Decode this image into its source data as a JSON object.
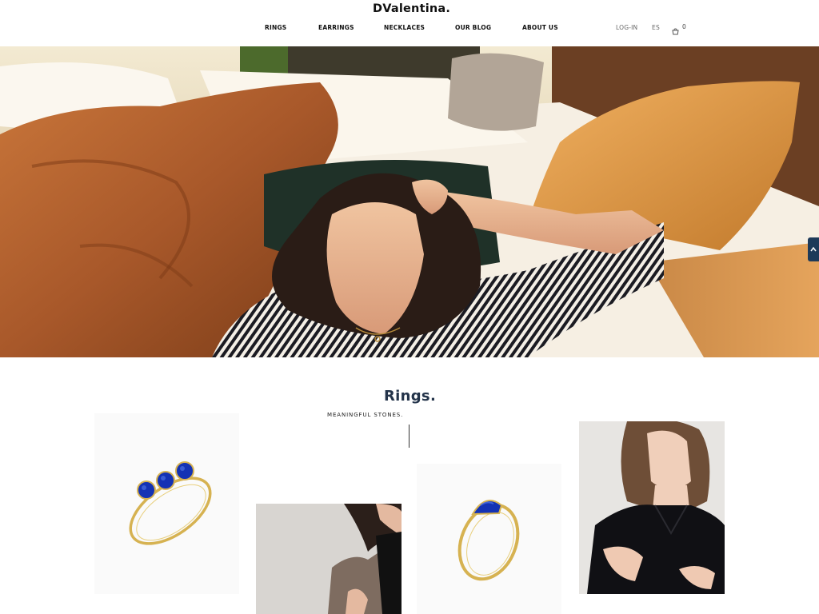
{
  "brand": {
    "logo": "DValentina."
  },
  "nav": {
    "items": [
      {
        "label": "RINGS"
      },
      {
        "label": "EARRINGS"
      },
      {
        "label": "NECKLACES"
      },
      {
        "label": "OUR BLOG"
      },
      {
        "label": "ABOUT US"
      }
    ]
  },
  "utility": {
    "login": "LOG-IN",
    "language": "ES",
    "cart_count": "0"
  },
  "hero": {
    "icon": "hero-photo"
  },
  "section": {
    "title": "Rings.",
    "subtitle": "MEANINGFUL STONES."
  },
  "colors": {
    "title_blue": "#24344a",
    "accent_navy": "#1d3a59",
    "lapis_blue": "#1432b4",
    "gold": "#d4b04a"
  }
}
